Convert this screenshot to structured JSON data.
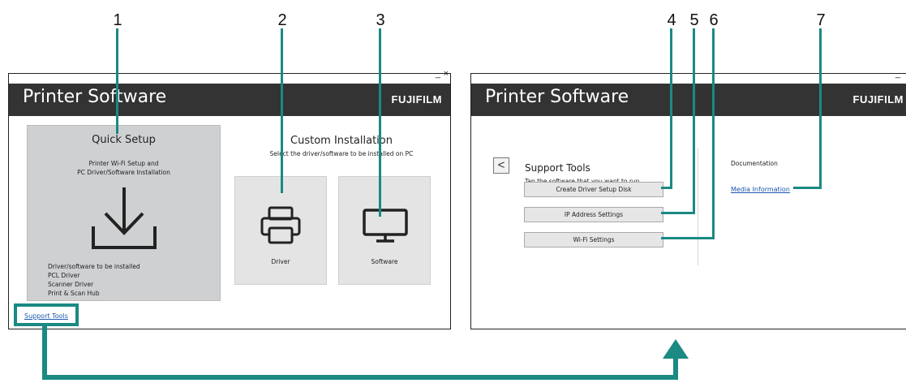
{
  "callouts": [
    "1",
    "2",
    "3",
    "4",
    "5",
    "6",
    "7"
  ],
  "left_window": {
    "title": "Printer Software",
    "brand": "FUJIFILM",
    "minimize": "_",
    "close": "×",
    "quick_setup": {
      "heading": "Quick Setup",
      "desc_line1": "Printer Wi-Fi Setup and",
      "desc_line2": "PC Driver/Software Installation",
      "list_heading": "Driver/software to be installed",
      "items": [
        "PCL Driver",
        "Scanner Driver",
        "Print & Scan Hub"
      ]
    },
    "custom": {
      "heading": "Custom Installation",
      "subheading": "Select the driver/software to be installed on PC",
      "driver_label": "Driver",
      "software_label": "Software"
    },
    "support_tools_link": "Support Tools"
  },
  "right_window": {
    "title": "Printer Software",
    "brand": "FUJIFILM",
    "minimize": "_",
    "back": "<",
    "heading": "Support Tools",
    "instruction": "Tap the software that you want to run.",
    "buttons": [
      {
        "label": "Create Driver Setup Disk"
      },
      {
        "label": "IP Address Settings"
      },
      {
        "label": "Wi-Fi Settings"
      }
    ],
    "documentation_label": "Documentation",
    "media_link": "Media Information"
  },
  "colors": {
    "accent": "#1a8a82",
    "header": "#333333",
    "link": "#1a56b0"
  }
}
